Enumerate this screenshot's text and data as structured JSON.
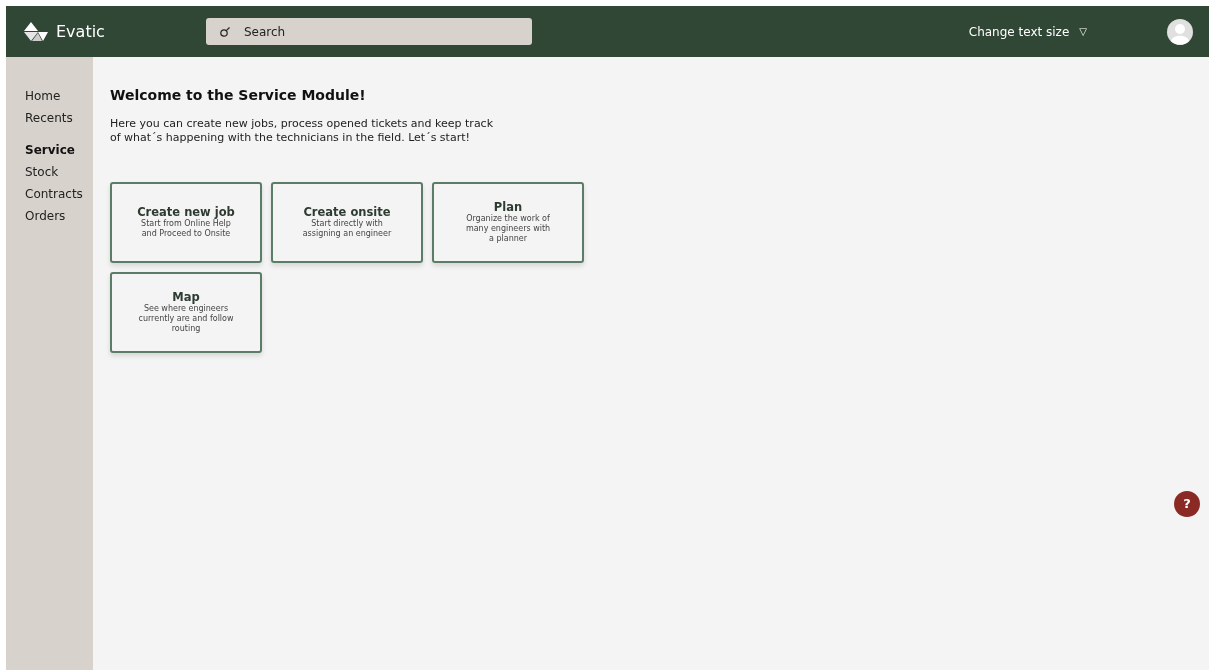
{
  "header": {
    "brand": "Evatic",
    "search": {
      "placeholder": "Search"
    },
    "text_size": {
      "label": "Change text size",
      "caret": "▽"
    }
  },
  "sidebar": {
    "groups": [
      {
        "items": [
          {
            "label": "Home",
            "selected": false
          },
          {
            "label": "Recents",
            "selected": false
          }
        ]
      },
      {
        "items": [
          {
            "label": "Service",
            "selected": true
          },
          {
            "label": "Stock",
            "selected": false
          },
          {
            "label": "Contracts",
            "selected": false
          },
          {
            "label": "Orders",
            "selected": false
          }
        ]
      }
    ]
  },
  "main": {
    "title": "Welcome to the Service Module!",
    "intro": [
      "Here you can create new jobs, process opened tickets and keep track",
      "of what´s happening with the technicians in the field. Let´s start!"
    ],
    "tiles": [
      {
        "title": "Create new job",
        "lines": [
          "Start from Online Help",
          "and Proceed to Onsite"
        ]
      },
      {
        "title": "Create onsite",
        "lines": [
          "Start directly with",
          "assigning an engineer"
        ]
      },
      {
        "title": "Plan",
        "lines": [
          "Organize the work of",
          "many engineers with",
          "a planner"
        ]
      },
      {
        "title": "Map",
        "lines": [
          "See where engineers",
          "currently are and follow",
          "routing"
        ]
      }
    ]
  },
  "help_button": {
    "label": "?"
  }
}
